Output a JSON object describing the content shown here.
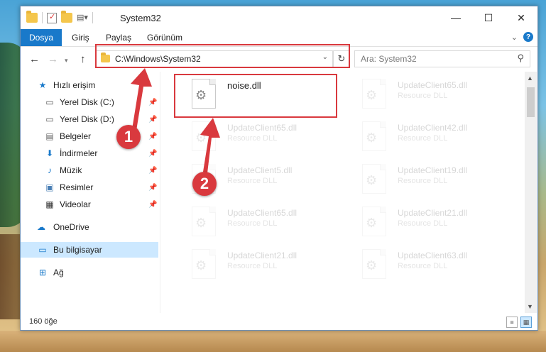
{
  "window": {
    "title": "System32"
  },
  "ribbon": {
    "tabs": [
      "Dosya",
      "Giriş",
      "Paylaş",
      "Görünüm"
    ]
  },
  "address": {
    "path": "C:\\Windows\\System32"
  },
  "search": {
    "placeholder": "Ara: System32"
  },
  "sidebar": {
    "items": [
      {
        "label": "Hızlı erişim"
      },
      {
        "label": "Yerel Disk (C:)"
      },
      {
        "label": "Yerel Disk (D:)"
      },
      {
        "label": "Belgeler"
      },
      {
        "label": "İndirmeler"
      },
      {
        "label": "Müzik"
      },
      {
        "label": "Resimler"
      },
      {
        "label": "Videolar"
      },
      {
        "label": "OneDrive"
      },
      {
        "label": "Bu bilgisayar"
      },
      {
        "label": "Ağ"
      }
    ]
  },
  "files": [
    {
      "name": "noise.dll",
      "type": ""
    },
    {
      "name": "UpdateClient65.dll",
      "type": "Resource DLL"
    },
    {
      "name": "UpdateClient65.dll",
      "type": "Resource DLL"
    },
    {
      "name": "UpdateClient42.dll",
      "type": "Resource DLL"
    },
    {
      "name": "UpdateClient5.dll",
      "type": "Resource DLL"
    },
    {
      "name": "UpdateClient19.dll",
      "type": "Resource DLL"
    },
    {
      "name": "UpdateClient65.dll",
      "type": "Resource DLL"
    },
    {
      "name": "UpdateClient21.dll",
      "type": "Resource DLL"
    },
    {
      "name": "UpdateClient21.dll",
      "type": "Resource DLL"
    },
    {
      "name": "UpdateClient63.dll",
      "type": "Resource DLL"
    }
  ],
  "status": {
    "count": "160 öğe"
  },
  "annotations": {
    "step1": "1",
    "step2": "2",
    "color": "#d9393e"
  }
}
